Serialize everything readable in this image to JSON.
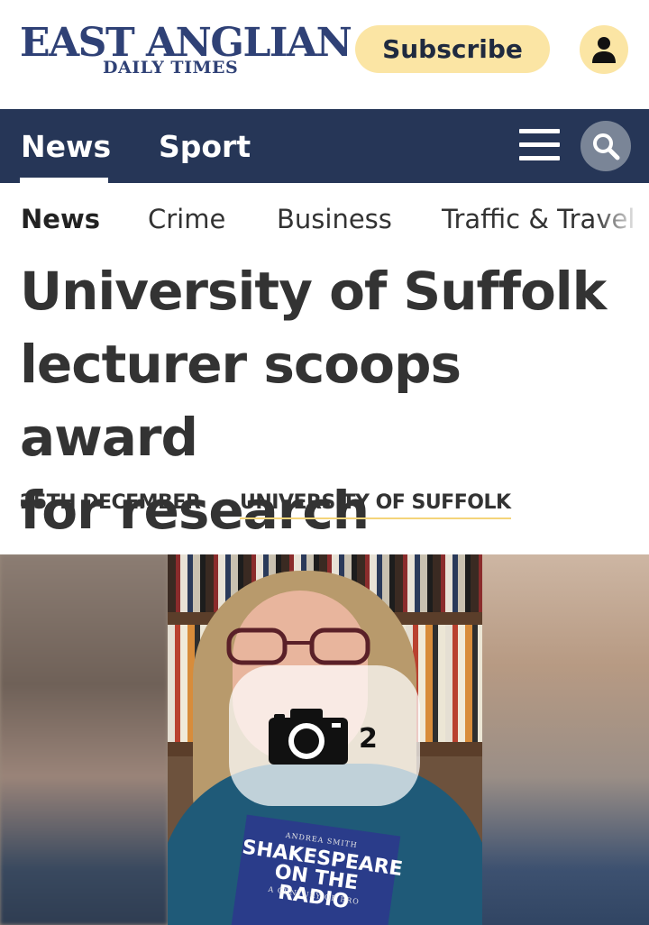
{
  "header": {
    "logo_main": "EAST ANGLIAN",
    "logo_sub": "DAILY TIMES",
    "subscribe_label": "Subscribe"
  },
  "nav": {
    "items": [
      {
        "label": "News",
        "active": true
      },
      {
        "label": "Sport",
        "active": false
      }
    ]
  },
  "subnav": {
    "items": [
      {
        "label": "News",
        "active": true
      },
      {
        "label": "Crime",
        "active": false
      },
      {
        "label": "Business",
        "active": false
      },
      {
        "label": "Traffic & Travel",
        "active": false
      }
    ]
  },
  "article": {
    "headline_lines": [
      "University of Suffolk",
      "lecturer scoops award",
      "for research"
    ],
    "date": "25TH DECEMBER",
    "tag": "UNIVERSITY OF SUFFOLK"
  },
  "media": {
    "gallery_count": "2",
    "book_author": "ANDREA SMITH",
    "book_title_lines": [
      "SHAKESPEARE",
      "ON THE RADIO"
    ],
    "book_subtitle": "A CENTURY OF BRO"
  },
  "colors": {
    "brand_navy": "#263657",
    "logo_blue": "#2f4176",
    "subscribe_yellow": "#fbe5a4"
  }
}
